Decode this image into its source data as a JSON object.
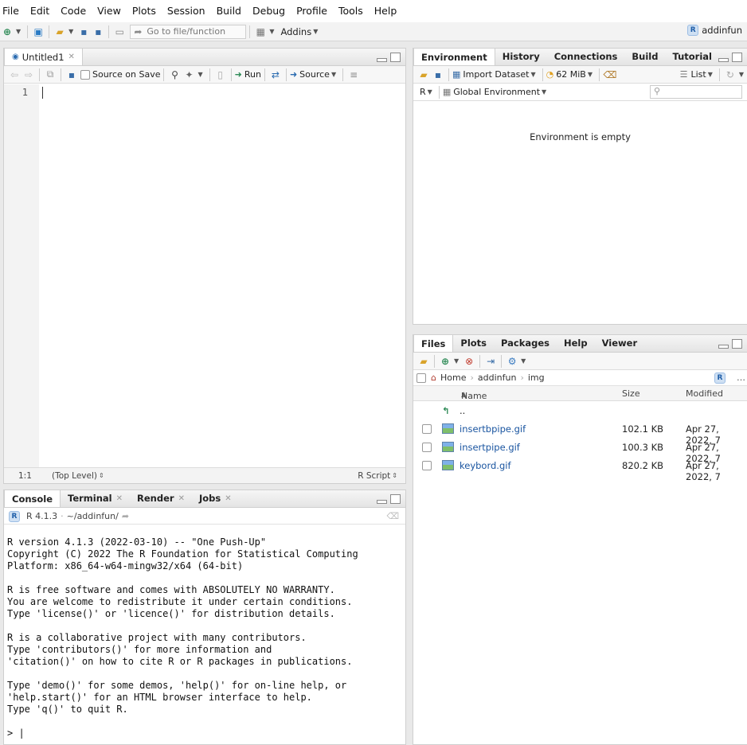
{
  "menu": [
    "File",
    "Edit",
    "Code",
    "View",
    "Plots",
    "Session",
    "Build",
    "Debug",
    "Profile",
    "Tools",
    "Help"
  ],
  "toolbar": {
    "goto_placeholder": "Go to file/function",
    "addins": "Addins",
    "project": "addinfun"
  },
  "editor": {
    "tab": "Untitled1",
    "source_on_save": "Source on Save",
    "run": "Run",
    "source": "Source",
    "line_number": "1",
    "position": "1:1",
    "scope": "(Top Level)",
    "filetype": "R Script"
  },
  "console": {
    "tabs": [
      "Console",
      "Terminal",
      "Render",
      "Jobs"
    ],
    "r_version": "R 4.1.3",
    "path": "~/addinfun/",
    "output": "R version 4.1.3 (2022-03-10) -- \"One Push-Up\"\nCopyright (C) 2022 The R Foundation for Statistical Computing\nPlatform: x86_64-w64-mingw32/x64 (64-bit)\n\nR is free software and comes with ABSOLUTELY NO WARRANTY.\nYou are welcome to redistribute it under certain conditions.\nType 'license()' or 'licence()' for distribution details.\n\nR is a collaborative project with many contributors.\nType 'contributors()' for more information and\n'citation()' on how to cite R or R packages in publications.\n\nType 'demo()' for some demos, 'help()' for on-line help, or\n'help.start()' for an HTML browser interface to help.\nType 'q()' to quit R.\n\n> |"
  },
  "environment": {
    "tabs": [
      "Environment",
      "History",
      "Connections",
      "Build",
      "Tutorial"
    ],
    "import_dataset": "Import Dataset",
    "memory": "62 MiB",
    "view_mode": "List",
    "language": "R",
    "scope": "Global Environment",
    "empty_message": "Environment is empty"
  },
  "files": {
    "tabs": [
      "Files",
      "Plots",
      "Packages",
      "Help",
      "Viewer"
    ],
    "breadcrumb": [
      "Home",
      "addinfun",
      "img"
    ],
    "columns": {
      "name": "Name",
      "size": "Size",
      "modified": "Modified"
    },
    "parent": "..",
    "rows": [
      {
        "name": "insertbpipe.gif",
        "size": "102.1 KB",
        "modified": "Apr 27, 2022, 7"
      },
      {
        "name": "insertpipe.gif",
        "size": "100.3 KB",
        "modified": "Apr 27, 2022, 7"
      },
      {
        "name": "keybord.gif",
        "size": "820.2 KB",
        "modified": "Apr 27, 2022, 7"
      }
    ]
  },
  "colors": {
    "accent": "#1f5ea8",
    "link": "#1a55a0",
    "run_green": "#2e8b57"
  }
}
